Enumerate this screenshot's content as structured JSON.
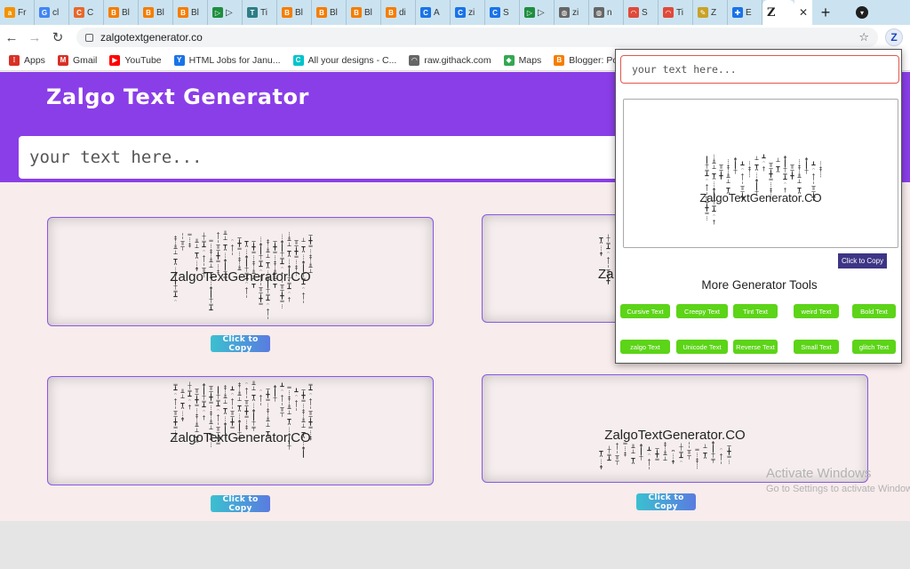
{
  "browser": {
    "tabs": [
      {
        "title": "Fr",
        "favicon": "amazon-icon",
        "color": "#f39200",
        "glyph": "a"
      },
      {
        "title": "cl",
        "favicon": "google-icon",
        "color": "#4285f4",
        "glyph": "G"
      },
      {
        "title": "C",
        "favicon": "canva-icon",
        "color": "#e8682c",
        "glyph": "C"
      },
      {
        "title": "Bl",
        "favicon": "blogger-icon",
        "color": "#f57d00",
        "glyph": "B"
      },
      {
        "title": "Bl",
        "favicon": "blogger-icon",
        "color": "#f57d00",
        "glyph": "B"
      },
      {
        "title": "Bl",
        "favicon": "blogger-icon",
        "color": "#f57d00",
        "glyph": "B"
      },
      {
        "title": "▷",
        "favicon": "sheets-icon",
        "color": "#1e8e3e",
        "glyph": "▷"
      },
      {
        "title": "Ti",
        "favicon": "tools-icon",
        "color": "#2e7d86",
        "glyph": "T"
      },
      {
        "title": "Bl",
        "favicon": "blogger-icon",
        "color": "#f57d00",
        "glyph": "B"
      },
      {
        "title": "Bl",
        "favicon": "blogger-icon",
        "color": "#f57d00",
        "glyph": "B"
      },
      {
        "title": "Bl",
        "favicon": "blogger-icon",
        "color": "#f57d00",
        "glyph": "B"
      },
      {
        "title": "di",
        "favicon": "blogger-icon",
        "color": "#f57d00",
        "glyph": "B"
      },
      {
        "title": "A",
        "favicon": "chrome-icon",
        "color": "#1a73e8",
        "glyph": "C"
      },
      {
        "title": "zi",
        "favicon": "chrome-icon",
        "color": "#1a73e8",
        "glyph": "C"
      },
      {
        "title": "S",
        "favicon": "chrome-icon",
        "color": "#1a73e8",
        "glyph": "C"
      },
      {
        "title": "▷",
        "favicon": "sheets-icon",
        "color": "#1e8e3e",
        "glyph": "▷"
      },
      {
        "title": "zi",
        "favicon": "globe-icon",
        "color": "#666666",
        "glyph": "◍"
      },
      {
        "title": "n",
        "favicon": "globe-icon",
        "color": "#666666",
        "glyph": "◍"
      },
      {
        "title": "S",
        "favicon": "rainbow-icon",
        "color": "#e04a3a",
        "glyph": "◠"
      },
      {
        "title": "Ti",
        "favicon": "rainbow-icon",
        "color": "#e04a3a",
        "glyph": "◠"
      },
      {
        "title": "Z",
        "favicon": "pencil-icon",
        "color": "#c9a227",
        "glyph": "✎"
      },
      {
        "title": "E",
        "favicon": "puzzle-icon",
        "color": "#1a73e8",
        "glyph": "✚"
      }
    ],
    "active_tab": {
      "favicon_text": "Z"
    },
    "url": "zalgotextgenerator.co",
    "extension_letter": "Z",
    "bookmarks": [
      {
        "label": "Apps",
        "icon": "apps-grid-icon",
        "color": "#d93025",
        "glyph": "⁞"
      },
      {
        "label": "Gmail",
        "icon": "gmail-icon",
        "color": "#d93025",
        "glyph": "M"
      },
      {
        "label": "YouTube",
        "icon": "youtube-icon",
        "color": "#ff0000",
        "glyph": "▶"
      },
      {
        "label": "HTML Jobs for Janu...",
        "icon": "hiring-icon",
        "color": "#1a73e8",
        "glyph": "Y"
      },
      {
        "label": "All your designs - C...",
        "icon": "canva-icon",
        "color": "#00c4cc",
        "glyph": "C"
      },
      {
        "label": "raw.githack.com",
        "icon": "githack-icon",
        "color": "#666666",
        "glyph": "◠"
      },
      {
        "label": "Maps",
        "icon": "maps-icon",
        "color": "#34a853",
        "glyph": "◆"
      },
      {
        "label": "Blogger: Posts",
        "icon": "blogger-icon",
        "color": "#f57d00",
        "glyph": "B"
      }
    ]
  },
  "page": {
    "site_title": "Zalgo Text Generator",
    "input_placeholder": "your text here...",
    "copy_label": "Click to Copy",
    "cards": [
      {
        "text": "ZalgoTextGenerator.CO"
      },
      {
        "text": "Za"
      },
      {
        "text": "ZalgoTextGenerator.CO"
      },
      {
        "text": "ZalgoTextGenerator.CO"
      }
    ]
  },
  "popup": {
    "input_placeholder": "your text here...",
    "output_text": "ZalgoTextGenerator.CO",
    "copy_label": "Click to Copy",
    "more_title": "More Generator Tools",
    "tools": [
      "Cursive Text",
      "Creepy Text",
      "Tint Text",
      "weird Text",
      "Bold Text",
      "zalgo Text",
      "Unicode Text",
      "Reverse Text",
      "Small Text",
      "glitch Text"
    ]
  },
  "overlay": {
    "activate_title": "Activate Windows",
    "activate_sub": "Go to Settings to activate Windows."
  },
  "colors": {
    "header": "#8a3ee8",
    "card_border": "#8a56e8",
    "tool_button": "#5cd418",
    "popup_copy": "#3d3585"
  }
}
